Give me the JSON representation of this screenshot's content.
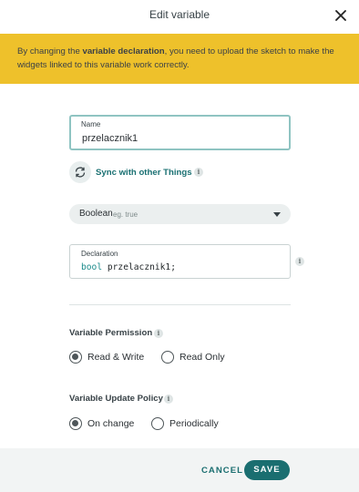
{
  "dialog": {
    "title": "Edit variable",
    "close_icon": "close-icon"
  },
  "banner": {
    "text_before": "By changing the ",
    "text_bold": "variable declaration",
    "text_after": ", you need to upload the sketch to make the widgets linked to this variable work correctly.",
    "color": "#eec12b"
  },
  "name_field": {
    "label": "Name",
    "value": "przelacznik1"
  },
  "sync": {
    "label": "Sync with other Things",
    "icon": "sync-icon",
    "info_icon": "info-icon"
  },
  "type_select": {
    "value": "Boolean",
    "hint": "eg. true"
  },
  "declaration": {
    "label": "Declaration",
    "keyword": "bool",
    "rest": " przelacznik1;"
  },
  "permission": {
    "title": "Variable Permission",
    "options": [
      {
        "label": "Read & Write",
        "checked": true
      },
      {
        "label": "Read Only",
        "checked": false
      }
    ]
  },
  "update_policy": {
    "title": "Variable Update Policy",
    "options": [
      {
        "label": "On change",
        "checked": true
      },
      {
        "label": "Periodically",
        "checked": false
      }
    ]
  },
  "footer": {
    "cancel_label": "CANCEL",
    "save_label": "SAVE",
    "accent": "#1a6e70"
  }
}
